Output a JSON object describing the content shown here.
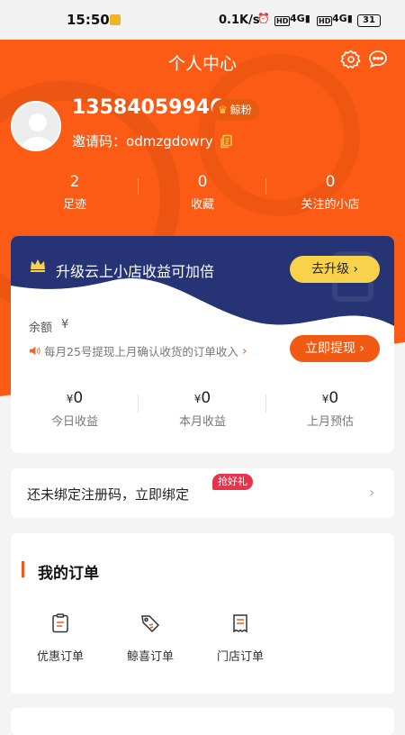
{
  "status_bar": {
    "time": "15:50",
    "network_speed": "0.1K/s",
    "hd1": "HD",
    "signal1": "4G",
    "hd2": "HD",
    "signal2": "4G",
    "battery": "31"
  },
  "header": {
    "title": "个人中心",
    "settings_icon": "gear-icon",
    "message_icon": "chat-bubble-icon"
  },
  "profile": {
    "phone": "13584059946",
    "badge_label": "鲸粉",
    "invite_label": "邀请码：",
    "invite_code": "odmzgdowry"
  },
  "stats": [
    {
      "value": "2",
      "label": "足迹"
    },
    {
      "value": "0",
      "label": "收藏"
    },
    {
      "value": "0",
      "label": "关注的小店"
    }
  ],
  "wallet": {
    "upgrade_text": "升级云上小店收益可加倍",
    "upgrade_button": "去升级",
    "balance_label": "余额",
    "balance_currency": "¥",
    "notice": "每月25号提现上月确认收货的订单收入",
    "withdraw_button": "立即提现",
    "earnings": [
      {
        "currency": "¥",
        "value": "0",
        "label": "今日收益"
      },
      {
        "currency": "¥",
        "value": "0",
        "label": "本月收益"
      },
      {
        "currency": "¥",
        "value": "0",
        "label": "上月预估"
      }
    ]
  },
  "bind": {
    "text": "还未绑定注册码，立即绑定",
    "badge": "抢好礼"
  },
  "orders": {
    "title": "我的订单",
    "items": [
      {
        "label": "优惠订单",
        "icon": "coupon-clipboard-icon"
      },
      {
        "label": "鲸喜订单",
        "icon": "tag-icon"
      },
      {
        "label": "门店订单",
        "icon": "receipt-icon"
      }
    ]
  },
  "colors": {
    "brand_orange": "#fb5b14",
    "navy": "#263374",
    "gold": "#f7d24a",
    "badge_red": "#e8334a"
  }
}
